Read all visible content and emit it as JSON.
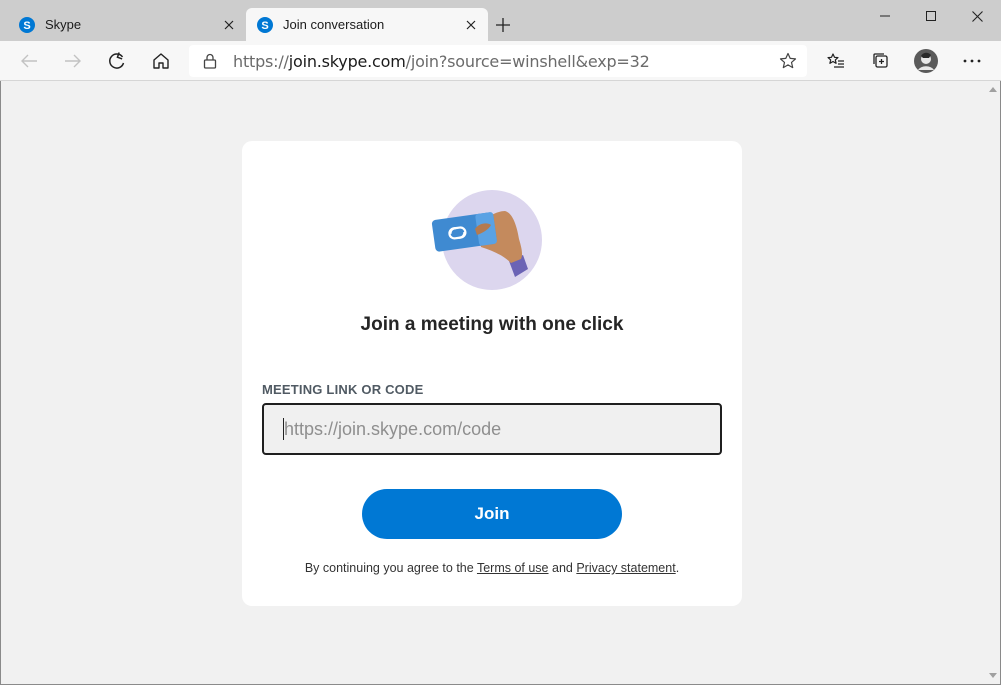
{
  "browser": {
    "tabs": [
      {
        "label": "Skype",
        "active": false,
        "favicon": "skype-icon"
      },
      {
        "label": "Join conversation",
        "active": true,
        "favicon": "skype-icon"
      }
    ],
    "new_tab_icon": "plus-icon",
    "window_controls": [
      "minimize-icon",
      "maximize-icon",
      "close-icon"
    ],
    "toolbar_icons": [
      "back-arrow-icon",
      "forward-arrow-icon",
      "refresh-icon",
      "home-icon",
      "lock-icon",
      "favorite-star-icon",
      "favorites-list-icon",
      "collections-icon",
      "profile-avatar",
      "more-dots-icon"
    ],
    "address": {
      "prefix": "https://",
      "host": "join.skype.com",
      "path": "/join?source=winshell&exp=32"
    }
  },
  "page": {
    "title": "Join a meeting with one click",
    "field_label": "MEETING LINK OR CODE",
    "field_placeholder": "https://join.skype.com/code",
    "field_value": "",
    "join_label": "Join",
    "legal_prefix": "By continuing you agree to the",
    "terms_link": "Terms of use",
    "legal_and": "and",
    "privacy_link": "Privacy statement",
    "legal_suffix": "."
  },
  "colors": {
    "accent": "#0078d4",
    "skype_blue": "#0078d4",
    "card_bg": "#ffffff",
    "page_bg": "#f1f1f1",
    "illustration_circle": "#dcd6ee",
    "illustration_card": "#3f8ad1",
    "illustration_sleeve": "#6b63b5"
  }
}
